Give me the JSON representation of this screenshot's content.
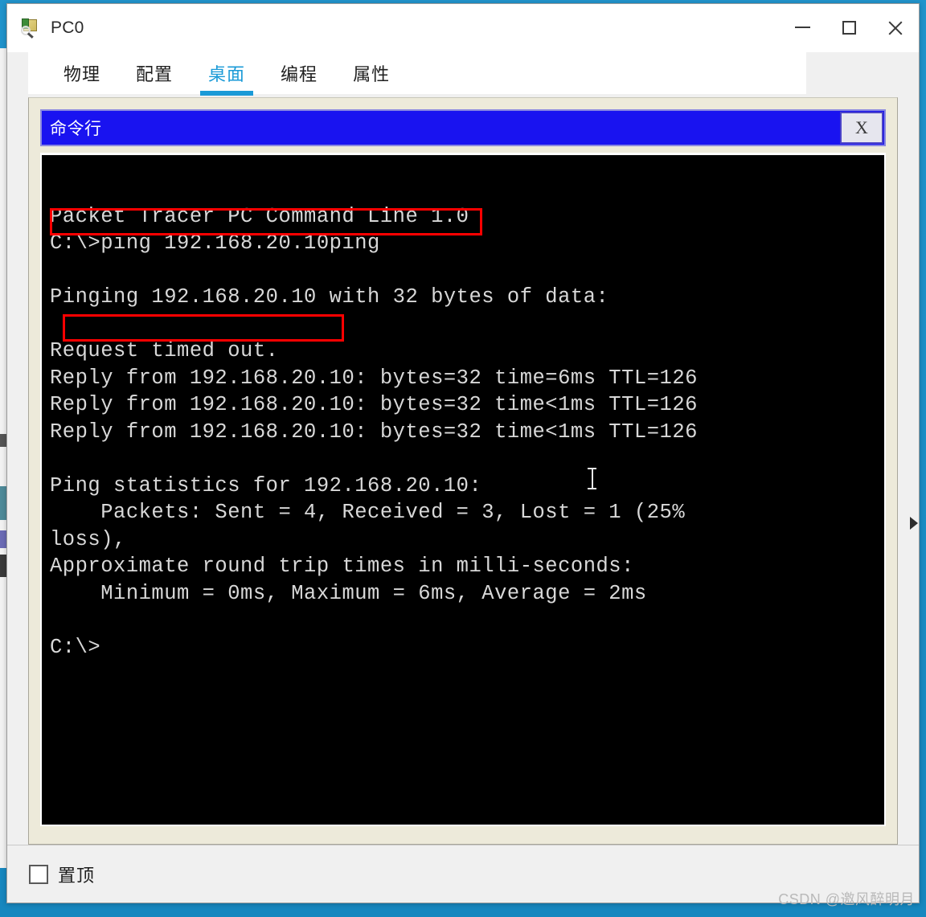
{
  "window": {
    "title": "PC0",
    "icon": "packet-tracer-pc-icon",
    "controls": {
      "minimize": "–",
      "maximize": "□",
      "close": "✕"
    }
  },
  "tabs": [
    {
      "label": "物理",
      "active": false
    },
    {
      "label": "配置",
      "active": false
    },
    {
      "label": "桌面",
      "active": true
    },
    {
      "label": "编程",
      "active": false
    },
    {
      "label": "属性",
      "active": false
    }
  ],
  "cmd_window": {
    "title": "命令行",
    "close_label": "X",
    "accent_color": "#1913f0"
  },
  "terminal": {
    "background": "#000000",
    "foreground": "#d8d8d8",
    "lines": [
      "",
      "Packet Tracer PC Command Line 1.0",
      "C:\\>ping 192.168.20.10ping",
      "",
      "Pinging 192.168.20.10 with 32 bytes of data:",
      "",
      "Request timed out.",
      "Reply from 192.168.20.10: bytes=32 time=6ms TTL=126",
      "Reply from 192.168.20.10: bytes=32 time<1ms TTL=126",
      "Reply from 192.168.20.10: bytes=32 time<1ms TTL=126",
      "",
      "Ping statistics for 192.168.20.10:",
      "    Packets: Sent = 4, Received = 3, Lost = 1 (25%",
      "loss),",
      "Approximate round trip times in milli-seconds:",
      "    Minimum = 0ms, Maximum = 6ms, Average = 2ms",
      "",
      "C:\\>"
    ],
    "annotations": [
      {
        "name": "ping-command-highlight",
        "color": "#ff0000",
        "target": "C:\\>ping 192.168.20.10ping"
      },
      {
        "name": "request-timed-out-highlight",
        "color": "#ff0000",
        "target": "Request timed out."
      }
    ],
    "ping_result": {
      "target_ip": "192.168.20.10",
      "payload_bytes": 32,
      "sent": 4,
      "received": 3,
      "lost": 1,
      "loss_percent": "25%",
      "min_ms": "0ms",
      "max_ms": "6ms",
      "avg_ms": "2ms",
      "ttl": 126
    }
  },
  "footer": {
    "ontop_label": "置顶",
    "ontop_checked": false
  },
  "watermark": "CSDN @邀风醉明月"
}
